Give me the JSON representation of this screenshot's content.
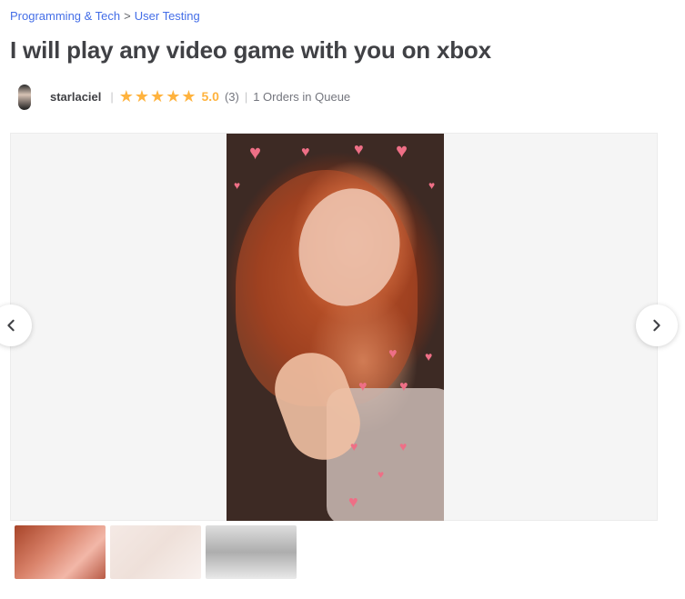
{
  "breadcrumb": {
    "category": "Programming & Tech",
    "separator": ">",
    "subcategory": "User Testing"
  },
  "gig": {
    "title": "I will play any video game with you on xbox"
  },
  "seller": {
    "name": "starlaciel",
    "rating_value": "5.0",
    "stars_filled": 5,
    "reviews": "(3)",
    "queue": "1 Orders in Queue"
  },
  "gallery": {
    "thumbnails": [
      "thumbnail-1",
      "thumbnail-2",
      "thumbnail-3"
    ],
    "prev_icon": "chevron-left-icon",
    "next_icon": "chevron-right-icon"
  },
  "colors": {
    "link": "#446ee7",
    "star": "#ffb33e",
    "title": "#404145",
    "muted": "#74767e"
  }
}
